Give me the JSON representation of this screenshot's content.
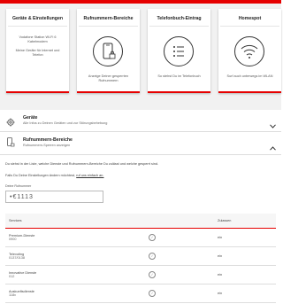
{
  "cards": [
    {
      "title": "Geräte & Einstellungen",
      "icon": "router-icon",
      "desc": "Vodafone Station Wi-Fi 6\nKabelmodem\n\nMeine Geräte für Internet und Telefon"
    },
    {
      "title": "Rufnummern-Bereiche",
      "icon": "phone-lock-icon",
      "desc": "Anzeige Deiner gesperrten Rufnummern"
    },
    {
      "title": "Telefonbuch-Eintrag",
      "icon": "list-icon",
      "desc": "So stehst Du im Telefonbuch"
    },
    {
      "title": "Homespot",
      "icon": "wifi-icon",
      "desc": "Surf auch unterwegs im WLAN"
    }
  ],
  "accordion": {
    "devices": {
      "title": "Geräte",
      "subtitle": "Alle Infos zu Deinen Geräten und zur Störungsbehebung",
      "icon": "gear-icon"
    },
    "numbers": {
      "title": "Rufnummern-Bereiche",
      "subtitle": "Rufnummern-Sperren anzeigen",
      "icon": "phone-lock-icon"
    }
  },
  "info_text": "Du siehst in der Liste, welche Dienste und Rufnummern-Bereiche Du zulässt und welche gesperrt sind.",
  "change_text": "Falls Du Deine Einstellungen ändern möchtest,",
  "change_link": "ruf uns einfach an.",
  "field_label": "Deine Rufnummer",
  "field_value": "•€1113",
  "table": {
    "headers": [
      "Services",
      "",
      "Zulassen"
    ],
    "rows": [
      {
        "name": "Premium-Dienste",
        "number": "0900",
        "allow": "ein"
      },
      {
        "name": "Televoting",
        "number": "0137/0138",
        "allow": "ein"
      },
      {
        "name": "Innovative Dienste",
        "number": "012",
        "allow": "ein"
      },
      {
        "name": "Auskunftsdienste",
        "number": "118x",
        "allow": "ein"
      }
    ]
  },
  "colors": {
    "accent": "#e60000",
    "background": "#f1f1f1"
  }
}
